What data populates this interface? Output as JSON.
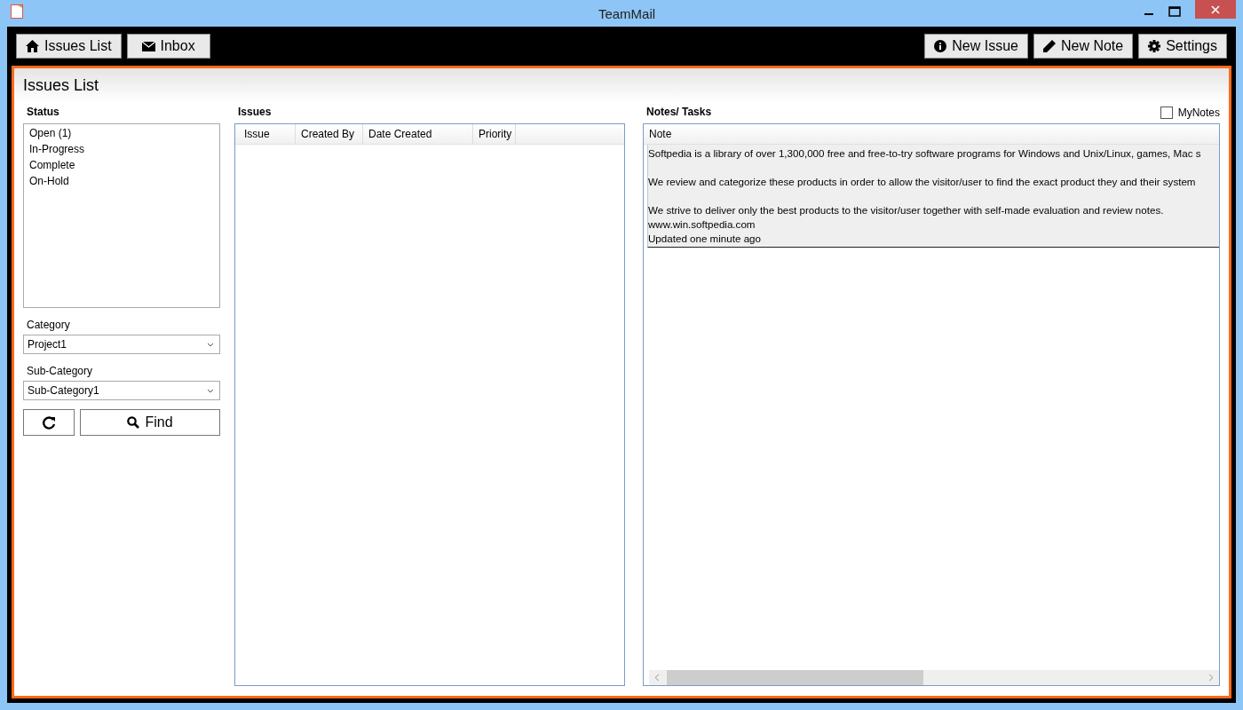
{
  "window": {
    "title": "TeamMail"
  },
  "toolbar": {
    "left": [
      {
        "label": "Issues List",
        "kind": "home"
      },
      {
        "label": "Inbox",
        "kind": "mail"
      }
    ],
    "right": [
      {
        "label": "New Issue",
        "kind": "info"
      },
      {
        "label": "New Note",
        "kind": "pencil"
      },
      {
        "label": "Settings",
        "kind": "gear"
      }
    ]
  },
  "page": {
    "title": "Issues List"
  },
  "status": {
    "heading": "Status",
    "items": [
      "Open (1)",
      "In-Progress",
      "Complete",
      "On-Hold"
    ]
  },
  "category": {
    "label": "Category",
    "value": "Project1"
  },
  "sub_category": {
    "label": "Sub-Category",
    "value": "Sub-Category1"
  },
  "find_button": {
    "label": "Find"
  },
  "issues": {
    "heading": "Issues",
    "columns": [
      "Issue",
      "Created By",
      "Date Created",
      "Priority"
    ]
  },
  "notes": {
    "heading": "Notes/ Tasks",
    "my_notes": {
      "label": "MyNotes",
      "checked": false
    },
    "column": "Note",
    "rows": [
      {
        "paragraphs": [
          [
            "Softpedia is a library of over 1,300,000 free and free-to-try software programs for Windows and Unix/Linux, games, Mac s"
          ],
          [
            "We review and categorize these products in order to allow the visitor/user to find the exact product they and their system"
          ],
          [
            "We strive to deliver only the best products to the visitor/user together with self-made evaluation and review notes.",
            "www.win.softpedia.com",
            "Updated one minute ago"
          ]
        ]
      }
    ]
  }
}
